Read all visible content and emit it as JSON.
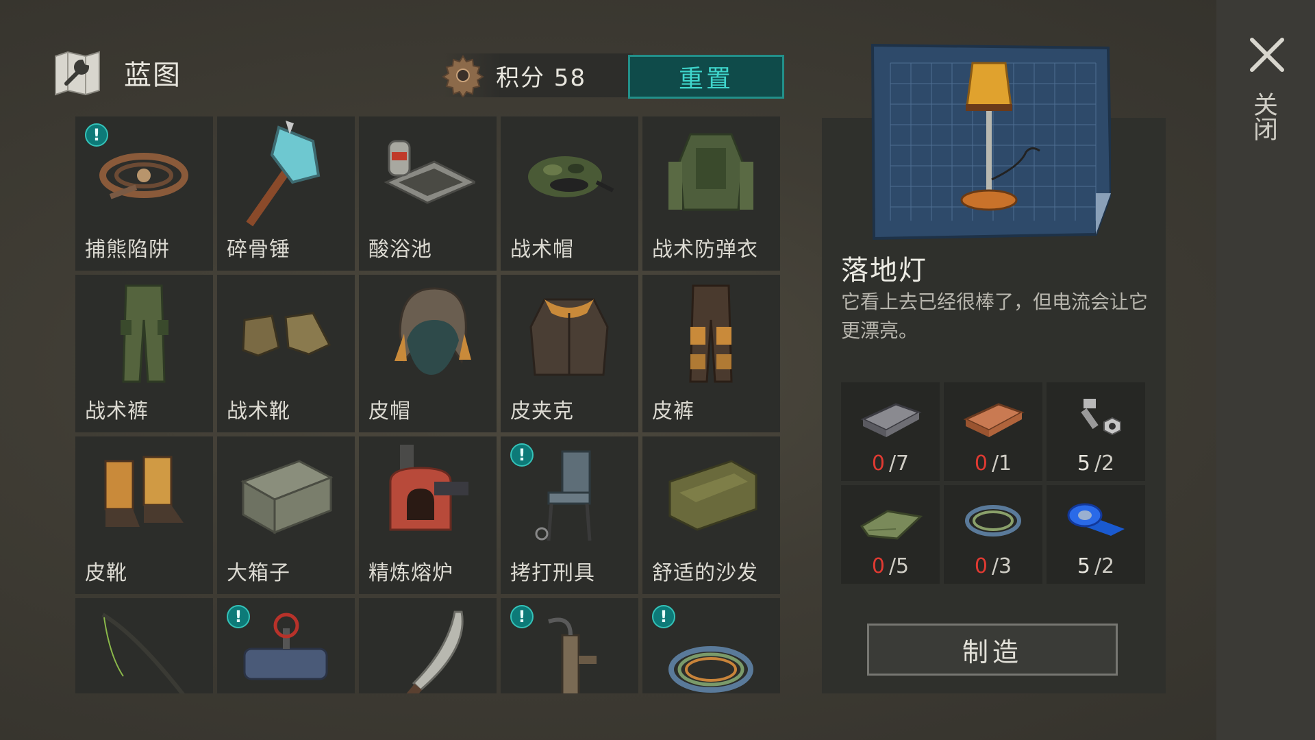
{
  "header": {
    "title": "蓝图",
    "icon": "blueprint-wrench-icon"
  },
  "score": {
    "text": "积分 58",
    "icon": "gear-icon"
  },
  "reset_label": "重置",
  "close_label": "关闭",
  "grid": {
    "items": [
      {
        "label": "捕熊陷阱",
        "alert": "!"
      },
      {
        "label": "碎骨锤"
      },
      {
        "label": "酸浴池"
      },
      {
        "label": "战术帽"
      },
      {
        "label": "战术防弹衣"
      },
      {
        "label": "战术裤"
      },
      {
        "label": "战术靴"
      },
      {
        "label": "皮帽"
      },
      {
        "label": "皮夹克"
      },
      {
        "label": "皮裤"
      },
      {
        "label": "皮靴"
      },
      {
        "label": "大箱子"
      },
      {
        "label": "精炼熔炉"
      },
      {
        "label": "拷打刑具",
        "alert": "!"
      },
      {
        "label": "舒适的沙发"
      },
      {
        "icon": "fishing-rod-icon"
      },
      {
        "icon": "pipe-valve-icon",
        "alert": "!"
      },
      {
        "icon": "machete-icon"
      },
      {
        "icon": "water-pump-icon",
        "alert": "!"
      },
      {
        "icon": "wire-coil-icon",
        "alert": "!"
      }
    ]
  },
  "detail": {
    "name": "落地灯",
    "description": "它看上去已经很棒了，但电流会让它更漂亮。",
    "materials": [
      {
        "icon": "iron-ingot-icon",
        "have": "0",
        "need": "/7",
        "sufficient": false
      },
      {
        "icon": "copper-ingot-icon",
        "have": "0",
        "need": "/1",
        "sufficient": false
      },
      {
        "icon": "bolt-nut-icon",
        "have": "5",
        "need": "/2",
        "sufficient": true
      },
      {
        "icon": "fabric-icon",
        "have": "0",
        "need": "/5",
        "sufficient": false
      },
      {
        "icon": "wire-icon",
        "have": "0",
        "need": "/3",
        "sufficient": false
      },
      {
        "icon": "tape-icon",
        "have": "5",
        "need": "/2",
        "sufficient": true
      }
    ],
    "craft_label": "制造"
  },
  "colors": {
    "accent": "#22908a",
    "alert": "#0d7a78",
    "insufficient": "#e03a32"
  }
}
